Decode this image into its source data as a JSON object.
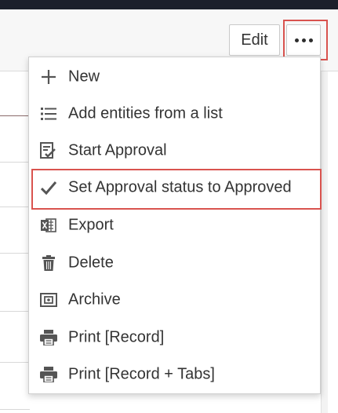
{
  "toolbar": {
    "edit_label": "Edit",
    "more_icon": "ellipsis-icon"
  },
  "menu": {
    "items": [
      {
        "label": "New",
        "icon": "plus-icon"
      },
      {
        "label": "Add entities from a list",
        "icon": "list-icon"
      },
      {
        "label": "Start Approval",
        "icon": "approval-icon"
      },
      {
        "label": "Set Approval status to Approved",
        "icon": "checkmark-icon"
      },
      {
        "label": "Export",
        "icon": "excel-icon"
      },
      {
        "label": "Delete",
        "icon": "trash-icon"
      },
      {
        "label": "Archive",
        "icon": "archive-icon"
      },
      {
        "label": "Print [Record]",
        "icon": "printer-icon"
      },
      {
        "label": "Print [Record + Tabs]",
        "icon": "printer-icon"
      }
    ]
  },
  "colors": {
    "highlight": "#d9534f",
    "icon": "#555555",
    "text": "#333333",
    "topbar": "#1b1f2b"
  }
}
